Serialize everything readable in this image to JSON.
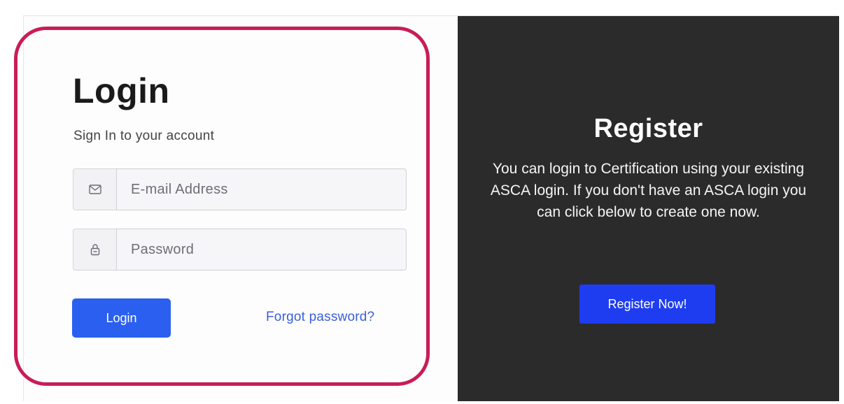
{
  "login": {
    "title": "Login",
    "subtitle": "Sign In to your account",
    "email_placeholder": "E-mail Address",
    "password_placeholder": "Password",
    "login_button": "Login",
    "forgot_link": "Forgot password?"
  },
  "register": {
    "title": "Register",
    "description": "You can login to Certification using your existing ASCA login. If you don't have an ASCA login you can click below to create one now.",
    "button": "Register Now!"
  },
  "icons": {
    "email": "envelope-icon",
    "password": "lock-icon"
  },
  "colors": {
    "highlight_border": "#c81d57",
    "primary_button": "#2a5ff0",
    "register_button": "#1f3df0",
    "register_background": "#2b2b2b",
    "link": "#3a5fd9"
  }
}
